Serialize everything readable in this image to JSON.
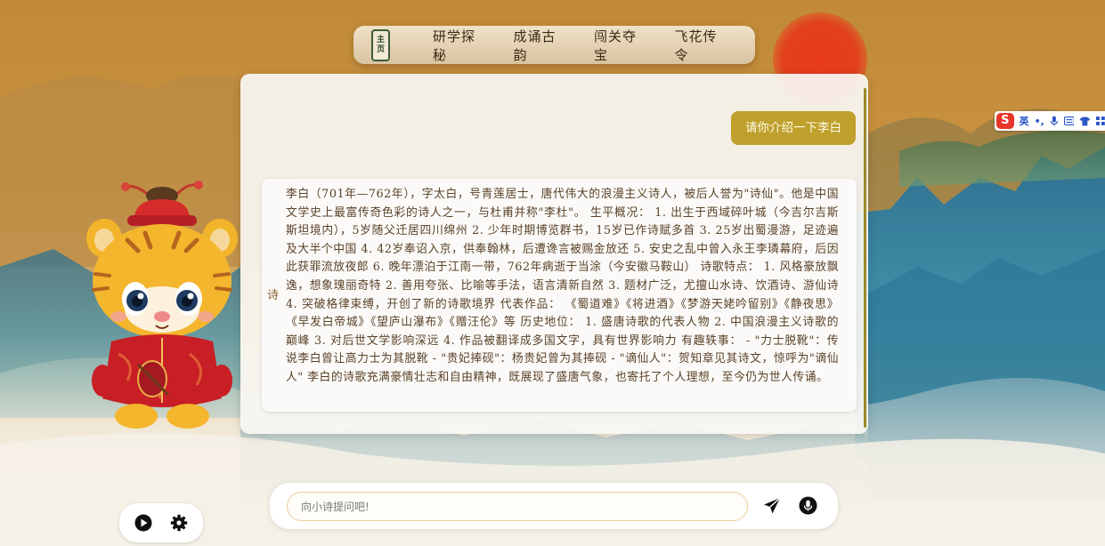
{
  "nav": {
    "logo_text": [
      "主",
      "页"
    ],
    "items": [
      "研学探秘",
      "成诵古韵",
      "闯关夺宝",
      "飞花传令"
    ]
  },
  "chat": {
    "user_message": "请你介绍一下李白",
    "bot_avatar_label": "诗",
    "bot_message": "李白（701年—762年），字太白，号青莲居士，唐代伟大的浪漫主义诗人，被后人誉为\"诗仙\"。他是中国文学史上最富传奇色彩的诗人之一，与杜甫并称\"李杜\"。 生平概况： 1. 出生于西域碎叶城（今吉尔吉斯斯坦境内），5岁随父迁居四川绵州 2. 少年时期博览群书，15岁已作诗赋多首 3. 25岁出蜀漫游，足迹遍及大半个中国 4. 42岁奉诏入京，供奉翰林，后遭谗言被赐金放还 5. 安史之乱中曾入永王李璘幕府，后因此获罪流放夜郎 6. 晚年漂泊于江南一带，762年病逝于当涂（今安徽马鞍山） 诗歌特点： 1. 风格豪放飘逸，想象瑰丽奇特 2. 善用夸张、比喻等手法，语言清新自然 3. 题材广泛，尤擅山水诗、饮酒诗、游仙诗 4. 突破格律束缚，开创了新的诗歌境界 代表作品： 《蜀道难》《将进酒》《梦游天姥吟留别》《静夜思》《早发白帝城》《望庐山瀑布》《赠汪伦》等 历史地位： 1. 盛唐诗歌的代表人物 2. 中国浪漫主义诗歌的巅峰 3. 对后世文学影响深远 4. 作品被翻译成多国文字，具有世界影响力 有趣轶事： - \"力士脱靴\"：传说李白曾让高力士为其脱靴 - \"贵妃捧砚\"：杨贵妃曾为其捧砚 - \"谪仙人\"：贺知章见其诗文，惊呼为\"谪仙人\" 李白的诗歌充满豪情壮志和自由精神，既展现了盛唐气象，也寄托了个人理想，至今仍为世人传诵。"
  },
  "input": {
    "placeholder": "向小诗提问吧!"
  },
  "ime": {
    "logo": "S",
    "mode": "英",
    "punct": "•,"
  },
  "colors": {
    "accent_gold": "#bfa02c",
    "sun_red": "#e2401e",
    "text_brown": "#5a4228"
  }
}
